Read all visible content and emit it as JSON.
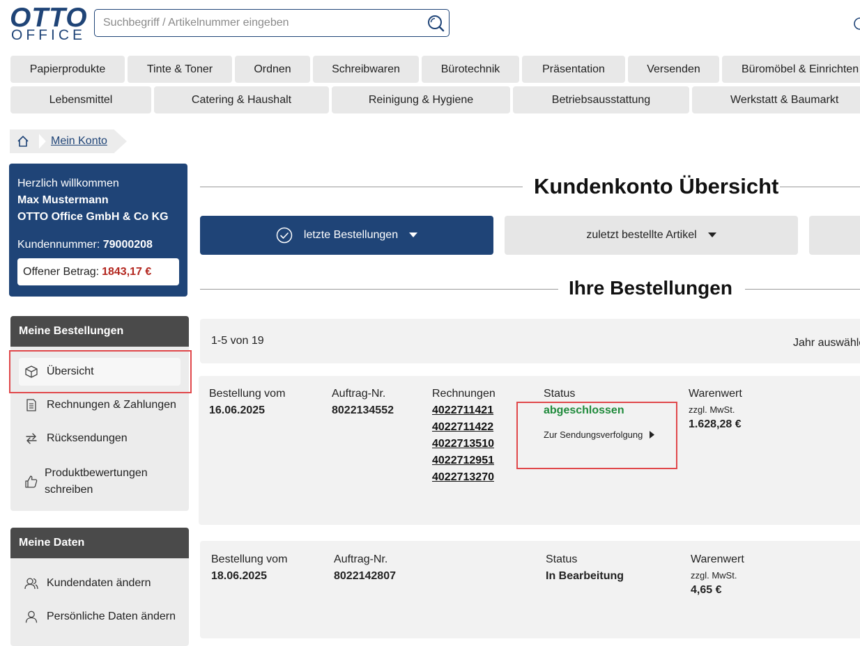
{
  "header": {
    "logo_top": "OTTO",
    "logo_bottom": "OFFICE",
    "search_placeholder": "Suchbegriff / Artikelnummer eingeben"
  },
  "categories_row1": [
    "Papierprodukte",
    "Tinte & Toner",
    "Ordnen",
    "Schreibwaren",
    "Bürotechnik",
    "Präsentation",
    "Versenden",
    "Büromöbel & Einrichten"
  ],
  "categories_row2": [
    "Lebensmittel",
    "Catering & Haushalt",
    "Reinigung & Hygiene",
    "Betriebsausstattung",
    "Werkstatt & Baumarkt"
  ],
  "breadcrumb": {
    "current": "Mein Konto"
  },
  "welcome": {
    "greeting": "Herzlich willkommen",
    "name": "Max Mustermann",
    "company": "OTTO Office GmbH & Co KG",
    "customer_label": "Kundennummer:",
    "customer_number": "79000208",
    "open_label": "Offener Betrag:",
    "open_amount": "1843,17 €"
  },
  "sidebar": {
    "orders_title": "Meine Bestellungen",
    "orders_items": [
      "Übersicht",
      "Rechnungen & Zahlungen",
      "Rücksendungen",
      "Produktbewertungen",
      "schreiben"
    ],
    "data_title": "Meine Daten",
    "data_items": [
      "Kundendaten ändern",
      "Persönliche Daten ändern"
    ]
  },
  "main": {
    "title": "Kundenkonto Übersicht",
    "tabs": [
      "letzte Bestellungen",
      "zuletzt bestellte Artikel"
    ],
    "orders_heading": "Ihre Bestellungen",
    "range": "1-5 von 19",
    "year_select": "Jahr auswähle"
  },
  "labels": {
    "order_date": "Bestellung vom",
    "order_no": "Auftrag-Nr.",
    "invoices": "Rechnungen",
    "status": "Status",
    "value": "Warenwert",
    "vat": "zzgl. MwSt.",
    "tracking": "Zur Sendungsverfolgung"
  },
  "orders": [
    {
      "date": "16.06.2025",
      "number": "8022134552",
      "invoices": [
        "4022711421",
        "4022711422",
        "4022713510",
        "4022712951",
        "4022713270"
      ],
      "status": "abgeschlossen",
      "amount": "1.628,28 €"
    },
    {
      "date": "18.06.2025",
      "number": "8022142807",
      "status": "In Bearbeitung",
      "amount": "4,65 €"
    }
  ],
  "colors": {
    "brand": "#1f4477",
    "status_done": "#1f8a3b",
    "amount_red": "#b3261e",
    "highlight": "#e0474a"
  }
}
